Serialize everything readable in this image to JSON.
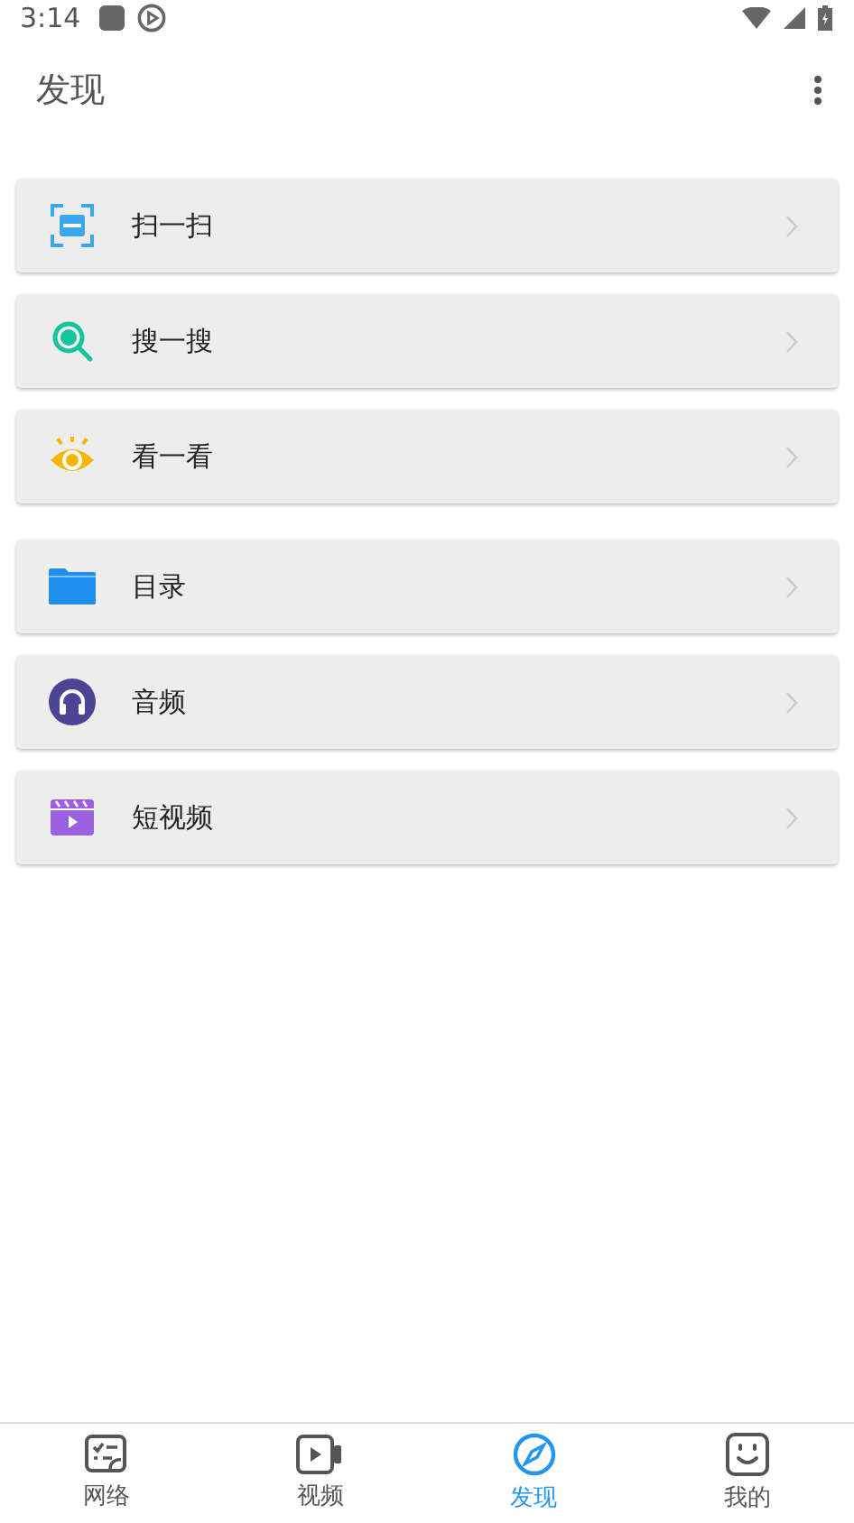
{
  "status_bar": {
    "time": "3:14"
  },
  "toolbar": {
    "title": "发现"
  },
  "groups": [
    {
      "items": [
        {
          "label": "扫一扫",
          "kind": "scan"
        },
        {
          "label": "搜一搜",
          "kind": "search"
        },
        {
          "label": "看一看",
          "kind": "eye"
        }
      ]
    },
    {
      "items": [
        {
          "label": "目录",
          "kind": "folder"
        },
        {
          "label": "音频",
          "kind": "headphones"
        },
        {
          "label": "短视频",
          "kind": "clip"
        }
      ]
    }
  ],
  "bottom_nav": [
    {
      "label": "网络",
      "kind": "network",
      "selected": false
    },
    {
      "label": "视频",
      "kind": "video",
      "selected": false
    },
    {
      "label": "发现",
      "kind": "compass",
      "selected": true
    },
    {
      "label": "我的",
      "kind": "face",
      "selected": false
    }
  ]
}
